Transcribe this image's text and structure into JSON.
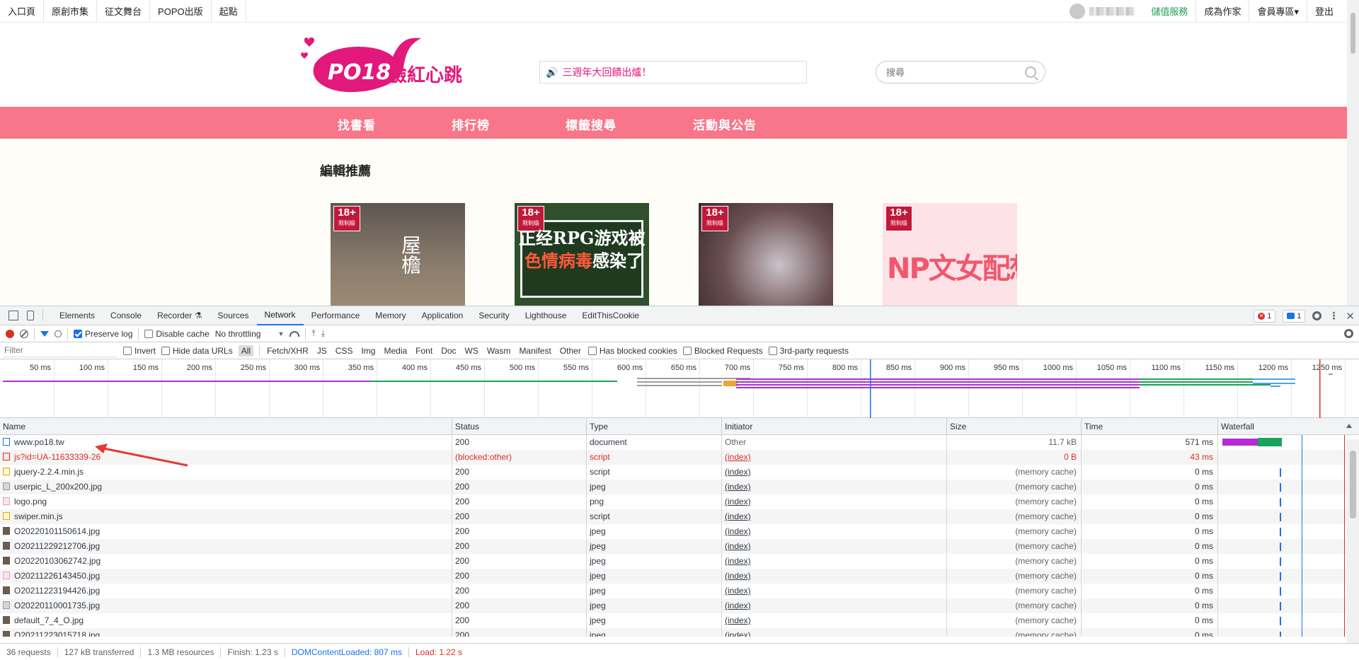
{
  "site": {
    "topnav_left": [
      "入口頁",
      "原創市集",
      "征文舞台",
      "POPO出版",
      "起點"
    ],
    "topnav_right": [
      "儲值服務",
      "成為作家",
      "會員專區▾",
      "登出"
    ],
    "logo_text": "臉紅心跳",
    "announcement": "三週年大回饋出爐！",
    "search_placeholder": "搜尋",
    "mainnav": [
      "找書看",
      "排行榜",
      "標籤搜尋",
      "活動與公告"
    ],
    "section_title": "編輯推薦",
    "books": [
      {
        "badge": "18+",
        "badge_sub": "限制級",
        "title": "屋檐"
      },
      {
        "badge": "18+",
        "badge_sub": "限制级",
        "line1": "正经RPG游戏被",
        "line2a": "色情病毒",
        "line2b": "感染了"
      },
      {
        "badge": "18+",
        "badge_sub": "限制级"
      },
      {
        "badge": "18+",
        "badge_sub": "限制级",
        "title": "NP文女配想罢工"
      }
    ],
    "brand_color": "#f8768a"
  },
  "devtools": {
    "tabs": [
      "Elements",
      "Console",
      "Recorder ⚗",
      "Sources",
      "Network",
      "Performance",
      "Memory",
      "Application",
      "Security",
      "Lighthouse",
      "EditThisCookie"
    ],
    "active_tab": "Network",
    "error_count": "1",
    "message_count": "1",
    "toolbar": {
      "preserve_log": "Preserve log",
      "disable_cache": "Disable cache",
      "throttling": "No throttling"
    },
    "filter": {
      "placeholder": "Filter",
      "invert": "Invert",
      "hide_data_urls": "Hide data URLs",
      "types": [
        "All",
        "Fetch/XHR",
        "JS",
        "CSS",
        "Img",
        "Media",
        "Font",
        "Doc",
        "WS",
        "Wasm",
        "Manifest",
        "Other"
      ],
      "has_blocked_cookies": "Has blocked cookies",
      "blocked_requests": "Blocked Requests",
      "third_party": "3rd-party requests"
    },
    "overview_ticks": [
      "50 ms",
      "100 ms",
      "150 ms",
      "200 ms",
      "250 ms",
      "300 ms",
      "350 ms",
      "400 ms",
      "450 ms",
      "500 ms",
      "550 ms",
      "600 ms",
      "650 ms",
      "700 ms",
      "750 ms",
      "800 ms",
      "850 ms",
      "900 ms",
      "950 ms",
      "1000 ms",
      "1050 ms",
      "1100 ms",
      "1150 ms",
      "1200 ms",
      "1250 ms"
    ],
    "columns": [
      "Name",
      "Status",
      "Type",
      "Initiator",
      "Size",
      "Time",
      "Waterfall"
    ],
    "requests": [
      {
        "name": "www.po18.tw",
        "status": "200",
        "type": "document",
        "initiator": "Other",
        "size": "11.7 kB",
        "time": "571 ms",
        "icon": "doc"
      },
      {
        "name": "js?id=UA-11633339-26",
        "status": "(blocked:other)",
        "type": "script",
        "initiator": "(index)",
        "size": "0 B",
        "time": "43 ms",
        "icon": "jserr",
        "error": true
      },
      {
        "name": "jquery-2.2.4.min.js",
        "status": "200",
        "type": "script",
        "initiator": "(index)",
        "size": "(memory cache)",
        "time": "0 ms",
        "icon": "js"
      },
      {
        "name": "userpic_L_200x200.jpg",
        "status": "200",
        "type": "jpeg",
        "initiator": "(index)",
        "size": "(memory cache)",
        "time": "0 ms",
        "icon": "imgl"
      },
      {
        "name": "logo.png",
        "status": "200",
        "type": "png",
        "initiator": "(index)",
        "size": "(memory cache)",
        "time": "0 ms",
        "icon": "png"
      },
      {
        "name": "swiper.min.js",
        "status": "200",
        "type": "script",
        "initiator": "(index)",
        "size": "(memory cache)",
        "time": "0 ms",
        "icon": "js"
      },
      {
        "name": "O20220101150614.jpg",
        "status": "200",
        "type": "jpeg",
        "initiator": "(index)",
        "size": "(memory cache)",
        "time": "0 ms",
        "icon": "img"
      },
      {
        "name": "O20211229212706.jpg",
        "status": "200",
        "type": "jpeg",
        "initiator": "(index)",
        "size": "(memory cache)",
        "time": "0 ms",
        "icon": "img"
      },
      {
        "name": "O20220103062742.jpg",
        "status": "200",
        "type": "jpeg",
        "initiator": "(index)",
        "size": "(memory cache)",
        "time": "0 ms",
        "icon": "img"
      },
      {
        "name": "O20211226143450.jpg",
        "status": "200",
        "type": "jpeg",
        "initiator": "(index)",
        "size": "(memory cache)",
        "time": "0 ms",
        "icon": "png"
      },
      {
        "name": "O20211223194426.jpg",
        "status": "200",
        "type": "jpeg",
        "initiator": "(index)",
        "size": "(memory cache)",
        "time": "0 ms",
        "icon": "img"
      },
      {
        "name": "O20220110001735.jpg",
        "status": "200",
        "type": "jpeg",
        "initiator": "(index)",
        "size": "(memory cache)",
        "time": "0 ms",
        "icon": "imgl"
      },
      {
        "name": "default_7_4_O.jpg",
        "status": "200",
        "type": "jpeg",
        "initiator": "(index)",
        "size": "(memory cache)",
        "time": "0 ms",
        "icon": "img"
      },
      {
        "name": "O20211223015718.jpg",
        "status": "200",
        "type": "jpeg",
        "initiator": "(index)",
        "size": "(memory cache)",
        "time": "0 ms",
        "icon": "img"
      }
    ],
    "status": {
      "requests": "36 requests",
      "transferred": "127 kB transferred",
      "resources": "1.3 MB resources",
      "finish": "Finish: 1.23 s",
      "dcl": "DOMContentLoaded: 807 ms",
      "load": "Load: 1.22 s"
    }
  }
}
